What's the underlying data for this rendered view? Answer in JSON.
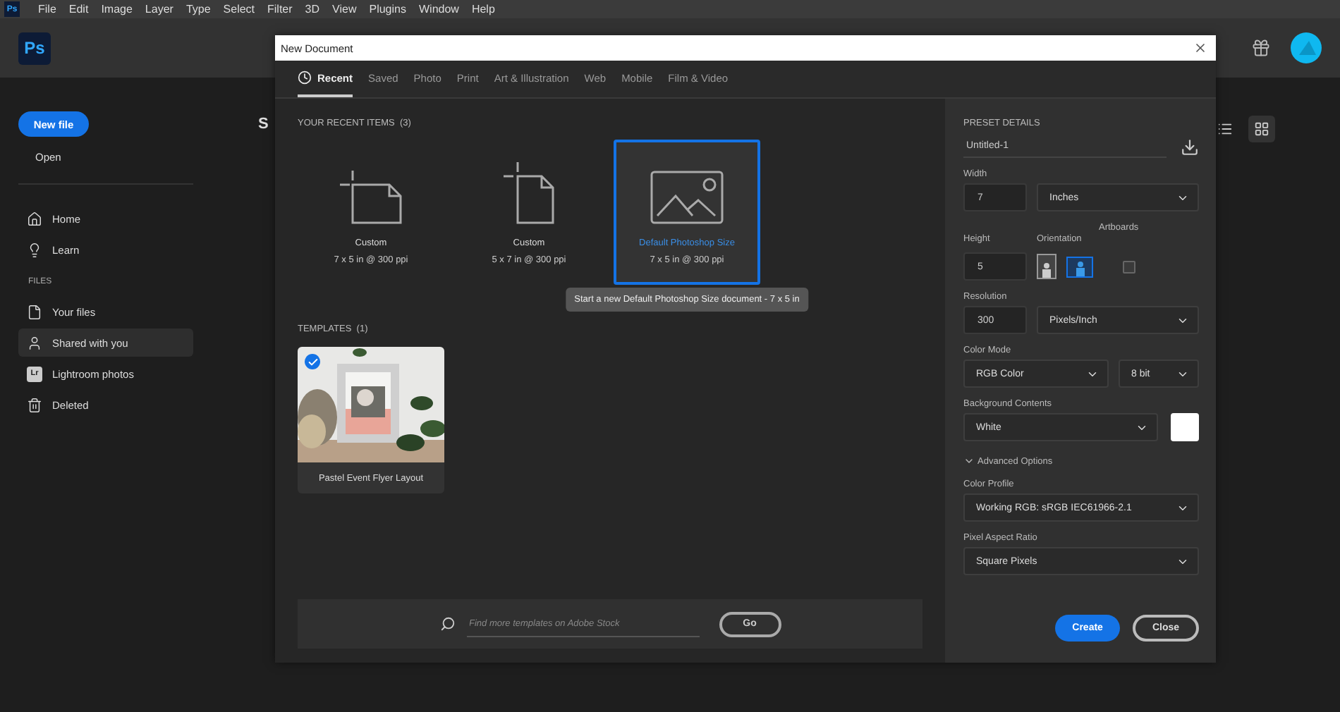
{
  "menu_bar": {
    "logo": "Ps",
    "items": [
      "File",
      "Edit",
      "Image",
      "Layer",
      "Type",
      "Select",
      "Filter",
      "3D",
      "View",
      "Plugins",
      "Window",
      "Help"
    ]
  },
  "header": {
    "logo": "Ps"
  },
  "sidebar": {
    "new_file": "New file",
    "open": "Open",
    "nav": [
      {
        "kind": "home",
        "label": "Home",
        "selected": false
      },
      {
        "kind": "learn",
        "label": "Learn",
        "selected": false
      }
    ],
    "files_heading": "FILES",
    "files": [
      {
        "kind": "file",
        "label": "Your files",
        "selected": false
      },
      {
        "kind": "shared",
        "label": "Shared with you",
        "selected": true
      },
      {
        "kind": "lightroom",
        "label": "Lightroom photos",
        "badge": "Lr",
        "selected": false
      },
      {
        "kind": "trash",
        "label": "Deleted",
        "selected": false
      }
    ]
  },
  "content": {
    "heading_fragment": "S",
    "view_toggle": [
      {
        "kind": "list",
        "selected": false
      },
      {
        "kind": "grid",
        "selected": true
      }
    ]
  },
  "dialog": {
    "title": "New Document",
    "tabs": [
      {
        "label": "Recent",
        "selected": true
      },
      {
        "label": "Saved",
        "selected": false
      },
      {
        "label": "Photo",
        "selected": false
      },
      {
        "label": "Print",
        "selected": false
      },
      {
        "label": "Art & Illustration",
        "selected": false
      },
      {
        "label": "Web",
        "selected": false
      },
      {
        "label": "Mobile",
        "selected": false
      },
      {
        "label": "Film & Video",
        "selected": false
      }
    ],
    "recent": {
      "heading": "YOUR RECENT ITEMS",
      "count": "(3)",
      "items": [
        {
          "kind": "landscape",
          "name": "Custom",
          "size": "7 x 5 in @ 300 ppi",
          "selected": false
        },
        {
          "kind": "portrait",
          "name": "Custom",
          "size": "5 x 7 in @ 300 ppi",
          "selected": false
        },
        {
          "kind": "picture",
          "name": "Default Photoshop Size",
          "size": "7 x 5 in @ 300 ppi",
          "selected": true,
          "tooltip": "Start a new Default Photoshop Size document - 7 x 5 in"
        }
      ]
    },
    "templates": {
      "heading": "TEMPLATES",
      "count": "(1)",
      "items": [
        {
          "name": "Pastel Event Flyer Layout",
          "checked": true
        }
      ]
    },
    "search": {
      "placeholder": "Find more templates on Adobe Stock",
      "button": "Go"
    },
    "details": {
      "heading": "PRESET DETAILS",
      "name": "Untitled-1",
      "width": {
        "label": "Width",
        "value": "7",
        "unit": "Inches"
      },
      "height": {
        "label": "Height",
        "value": "5"
      },
      "orientation": {
        "label": "Orientation",
        "options": [
          {
            "kind": "portrait",
            "selected": false
          },
          {
            "kind": "landscape",
            "selected": true
          }
        ]
      },
      "artboards": {
        "label": "Artboards",
        "checked": false
      },
      "resolution": {
        "label": "Resolution",
        "value": "300",
        "unit": "Pixels/Inch"
      },
      "color_mode": {
        "label": "Color Mode",
        "value": "RGB Color",
        "depth": "8 bit"
      },
      "background": {
        "label": "Background Contents",
        "value": "White",
        "color": "#ffffff"
      },
      "advanced": {
        "label": "Advanced Options",
        "expanded": true
      },
      "color_profile": {
        "label": "Color Profile",
        "value": "Working RGB: sRGB IEC61966-2.1"
      },
      "pixel_aspect": {
        "label": "Pixel Aspect Ratio",
        "value": "Square Pixels"
      },
      "buttons": [
        {
          "kind": "primary",
          "label": "Create"
        },
        {
          "kind": "secondary",
          "label": "Close"
        }
      ]
    }
  }
}
